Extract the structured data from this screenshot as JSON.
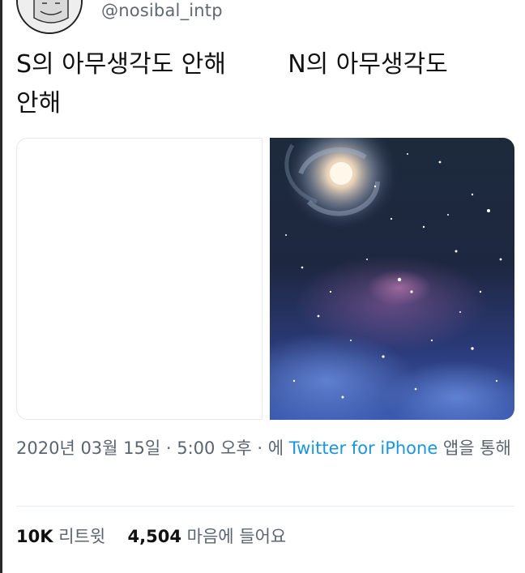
{
  "profile": {
    "handle": "@nosibal_intp",
    "avatar_icon": "avatar-illustration-icon"
  },
  "tweet": {
    "text": "S의 아무생각도 안해        N의 아무생각도\n안해"
  },
  "media": {
    "left_image": "blank-white-image",
    "right_image": "galaxy-space-image"
  },
  "meta": {
    "date": "2020년 03월 15일",
    "sep1": " · ",
    "time": "5:00 오후",
    "sep2": " · ",
    "via_prefix": "에 ",
    "source": "Twitter for iPhone",
    "via_suffix": " 앱을 통해"
  },
  "stats": {
    "retweets_count": "10K",
    "retweets_label": "리트윗",
    "likes_count": "4,504",
    "likes_label": "마음에 들어요"
  },
  "colors": {
    "link": "#1b95e0",
    "muted": "#5a6570",
    "text": "#111111"
  }
}
